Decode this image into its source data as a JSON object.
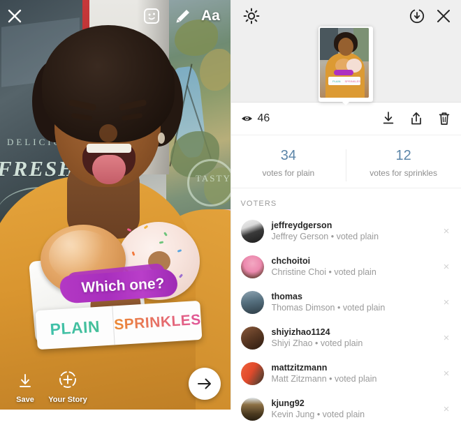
{
  "story": {
    "toolbar": {
      "close_label": "×",
      "sticker_icon": "sticker-smiley-icon",
      "pen_icon": "marker-pen-icon",
      "text_label": "Aa"
    },
    "poll": {
      "question": "Which one?",
      "option_one": "PLAIN",
      "option_two": "SPRINKLES",
      "option_one_color": "#35b6ad",
      "option_two_color": "#e0669a",
      "brush_color": "#ac31c0"
    },
    "photo_text": {
      "sign_top": "DELICIOUS",
      "sign_main": "FRESH PIES",
      "window_reflection": "TASTY"
    },
    "bottom": {
      "save_label": "Save",
      "save_icon": "download-arrow-icon",
      "your_story_label": "Your Story",
      "your_story_icon": "add-to-story-icon",
      "next_icon": "arrow-right-icon"
    }
  },
  "panel": {
    "header": {
      "settings_icon": "gear-icon",
      "download_icon": "download-circle-icon",
      "close_label": "×",
      "thumbnail_alt": "story-thumbnail"
    },
    "views": {
      "eye_icon": "eye-icon",
      "count": "46",
      "actions": [
        {
          "name": "download-button",
          "icon": "download-icon"
        },
        {
          "name": "share-button",
          "icon": "share-up-icon"
        },
        {
          "name": "delete-button",
          "icon": "trash-icon"
        }
      ]
    },
    "results": {
      "accent_color": "#5b85a8",
      "options": [
        {
          "count": "34",
          "label": "votes for plain"
        },
        {
          "count": "12",
          "label": "votes for sprinkles"
        }
      ]
    },
    "voters_header": "VOTERS",
    "voters": [
      {
        "username": "jeffreydgerson",
        "fullname": "Jeffrey Gerson",
        "separator": "•",
        "vote": "voted plain",
        "avatar_class": "a0"
      },
      {
        "username": "chchoitoi",
        "fullname": "Christine Choi",
        "separator": "•",
        "vote": "voted plain",
        "avatar_class": "a1"
      },
      {
        "username": "thomas",
        "fullname": "Thomas Dimson",
        "separator": "•",
        "vote": "voted plain",
        "avatar_class": "a2"
      },
      {
        "username": "shiyizhao1124",
        "fullname": "Shiyi Zhao",
        "separator": "•",
        "vote": "voted plain",
        "avatar_class": "a3"
      },
      {
        "username": "mattzitzmann",
        "fullname": "Matt Zitzmann",
        "separator": "•",
        "vote": "voted plain",
        "avatar_class": "a4"
      },
      {
        "username": "kjung92",
        "fullname": "Kevin Jung",
        "separator": "•",
        "vote": "voted plain",
        "avatar_class": "a5"
      }
    ],
    "remove_label": "×"
  }
}
